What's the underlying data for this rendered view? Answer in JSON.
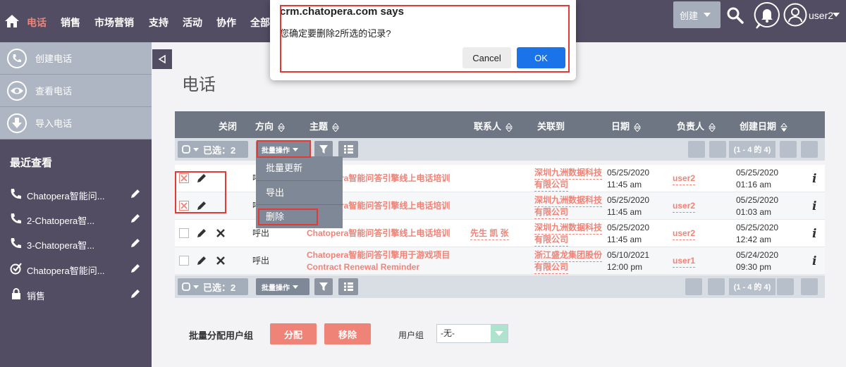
{
  "nav": {
    "items": [
      "电话",
      "销售",
      "市场营销",
      "支持",
      "活动",
      "协作",
      "全部"
    ],
    "create_label": "创建",
    "username": "user2"
  },
  "sidebar": {
    "actions": [
      "创建电话",
      "查看电话",
      "导入电话"
    ],
    "recent_title": "最近查看",
    "recent": [
      "Chatopera智能问...",
      "2-Chatopera智...",
      "3-Chatopera智...",
      "Chatopera智能问...",
      "销售"
    ]
  },
  "page": {
    "title": "电话"
  },
  "table": {
    "headers": [
      "关闭",
      "方向",
      "主题",
      "联系人",
      "关联到",
      "日期",
      "负责人",
      "创建日期"
    ],
    "toolbar": {
      "selected_label": "已选：2",
      "selected_label_bottom": "已选：2",
      "bulk_label": "批量操作",
      "range": "(1 - 4 的 4)"
    },
    "rows": [
      {
        "direction": "呼",
        "subject": "Chatopera智能问答引擎线上电话培训",
        "contact": "",
        "related1": "深圳九洲数据科技",
        "related2": "有限公司",
        "date": "05/25/2020",
        "time": "11:45 am",
        "owner": "user2",
        "created_date": "05/25/2020",
        "created_time": "01:16 am",
        "checked": true
      },
      {
        "direction": "呼",
        "subject": "Chatopera智能问答引擎线上电话培训",
        "contact": "",
        "related1": "深圳九洲数据科技",
        "related2": "有限公司",
        "date": "05/25/2020",
        "time": "11:45 am",
        "owner": "user2",
        "created_date": "05/25/2020",
        "created_time": "01:03 am",
        "checked": true
      },
      {
        "direction": "呼出",
        "subject": "Chatopera智能问答引擎线上电话培训",
        "contact": "先生 凯 张",
        "related1": "深圳九洲数据科技",
        "related2": "有限公司",
        "date": "05/25/2020",
        "time": "11:45 am",
        "owner": "user2",
        "created_date": "05/25/2020",
        "created_time": "12:42 am",
        "checked": false
      },
      {
        "direction": "呼出",
        "subject": "Chatopera智能问答引擎用于游戏项目",
        "subject2": "Contract Renewal Reminder",
        "contact": "",
        "related1": "浙江盛龙集团股份",
        "related2": "有限公司",
        "date": "05/10/2021",
        "time": "12:00 pm",
        "owner": "user1",
        "created_date": "05/24/2020",
        "created_time": "09:30 pm",
        "checked": false
      }
    ],
    "info_glyph": "i"
  },
  "bulk_menu": [
    "批量更新",
    "导出",
    "删除"
  ],
  "mass_assign": {
    "label": "批量分配用户组",
    "assign_label": "分配",
    "remove_label": "移除",
    "group_label": "用户组",
    "group_value": "-无-"
  },
  "dialog": {
    "title": "crm.chatopera.com says",
    "message": "您确定要删除2所选的记录?",
    "cancel_label": "Cancel",
    "ok_label": "OK"
  },
  "colors": {
    "nav_bg": "#534d64",
    "accent": "#f08377",
    "ok_blue": "#1a73e8",
    "highlight": "#e53935"
  }
}
